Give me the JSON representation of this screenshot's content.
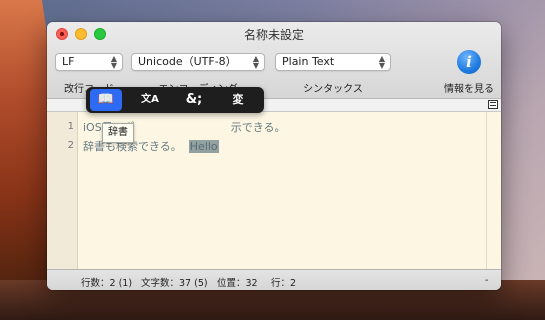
{
  "window": {
    "title": "名称未設定"
  },
  "toolbar": {
    "line_ending": {
      "value": "LF",
      "label": "改行コード"
    },
    "encoding": {
      "value": "Unicode（UTF-8）",
      "label": "エンコーディング"
    },
    "syntax": {
      "value": "Plain Text",
      "label": "シンタックス"
    },
    "info": {
      "icon": "i",
      "label": "情報を見る"
    }
  },
  "editor": {
    "lines": [
      {
        "number": "1",
        "text": "iOS風のポ",
        "text_after": "示できる。"
      },
      {
        "number": "2",
        "text": "辞書も検索で",
        "text_mid": "きる。",
        "selected": "Hello"
      }
    ]
  },
  "popover": {
    "buttons": [
      {
        "name": "dictionary",
        "glyph": "📖",
        "active": true
      },
      {
        "name": "translate",
        "glyph": "文A",
        "active": false
      },
      {
        "name": "entity",
        "glyph": "&;",
        "active": false
      },
      {
        "name": "transform",
        "glyph": "変",
        "active": false
      }
    ]
  },
  "tooltip": {
    "text": "辞書"
  },
  "statusbar": {
    "lines": "行数：2 (1)",
    "chars": "文字数：37 (5)",
    "position": "位置：32",
    "row": "行：2",
    "right": "-"
  },
  "colors": {
    "editor_bg": "#fdf6e3",
    "text": "#657b83",
    "selection": "#93a1a1",
    "popover_active": "#2e6bf5"
  }
}
